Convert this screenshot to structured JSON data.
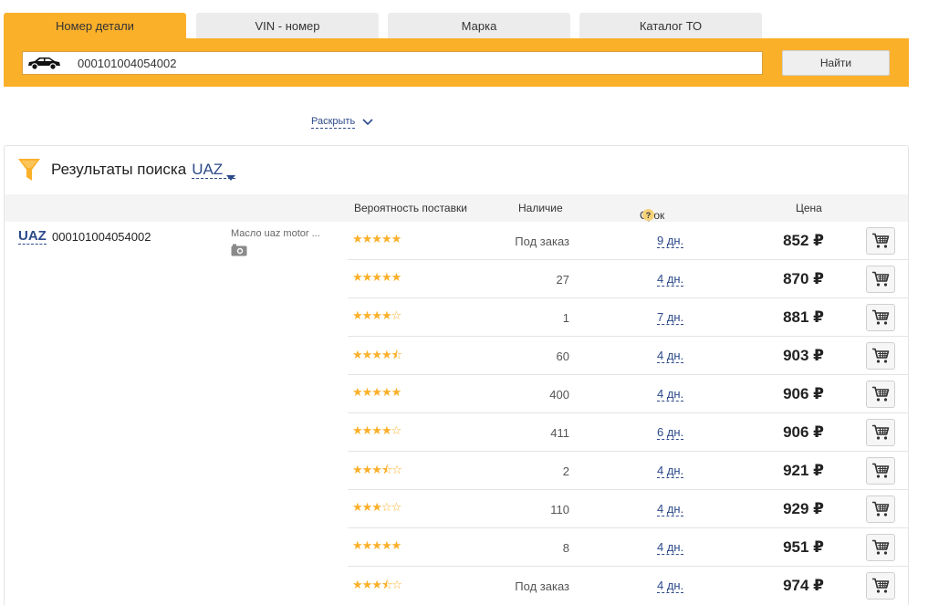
{
  "tabs": [
    {
      "label": "Номер детали",
      "active": true
    },
    {
      "label": "VIN - номер",
      "active": false
    },
    {
      "label": "Марка",
      "active": false
    },
    {
      "label": "Каталог ТО",
      "active": false
    }
  ],
  "search": {
    "value": "000101004054002",
    "button_label": "Найти"
  },
  "expand": {
    "label": "Раскрыть"
  },
  "results": {
    "title": "Результаты поиска",
    "brand_filter": "UAZ",
    "columns": {
      "probability": "Вероятность поставки",
      "stock": "Наличие",
      "term": "Срок",
      "term_help": "?",
      "price": "Цена"
    },
    "part": {
      "brand": "UAZ",
      "number": "000101004054002",
      "description": "Масло uaz motor ..."
    },
    "offers": [
      {
        "rating": 5,
        "stock": "Под заказ",
        "term": "9 дн.",
        "price": "852 ₽"
      },
      {
        "rating": 5,
        "stock": "27",
        "term": "4 дн.",
        "price": "870 ₽"
      },
      {
        "rating": 4,
        "stock": "1",
        "term": "7 дн.",
        "price": "881 ₽"
      },
      {
        "rating": 4.5,
        "stock": "60",
        "term": "4 дн.",
        "price": "903 ₽"
      },
      {
        "rating": 5,
        "stock": "400",
        "term": "4 дн.",
        "price": "906 ₽"
      },
      {
        "rating": 4,
        "stock": "411",
        "term": "6 дн.",
        "price": "906 ₽"
      },
      {
        "rating": 3.5,
        "stock": "2",
        "term": "4 дн.",
        "price": "921 ₽"
      },
      {
        "rating": 3,
        "stock": "110",
        "term": "4 дн.",
        "price": "929 ₽"
      },
      {
        "rating": 5,
        "stock": "8",
        "term": "4 дн.",
        "price": "951 ₽"
      },
      {
        "rating": 3.5,
        "stock": "Под заказ",
        "term": "4 дн.",
        "price": "974 ₽"
      }
    ]
  },
  "colors": {
    "accent": "#fbb02a",
    "link": "#2c4a8a"
  }
}
